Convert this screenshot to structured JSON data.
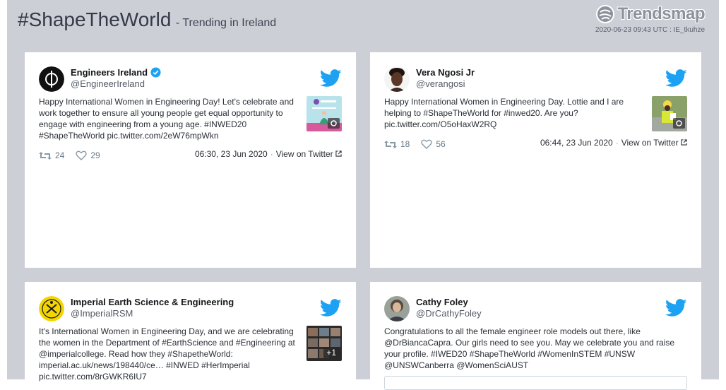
{
  "header": {
    "hashtag": "#ShapeTheWorld",
    "subtitle": "- Trending in Ireland",
    "brand": "Trendsmap",
    "stamp": "2020-06-23 09:43 UTC : IE_tkuhze"
  },
  "tweets": [
    {
      "name": "Engineers Ireland",
      "verified": true,
      "handle": "@EngineerIreland",
      "lines": [
        "Happy International Women in Engineering Day! Let's celebrate and",
        "work together to ensure all young people get equal opportunity to",
        "engage with engineering from a young age. #INWED20",
        "#ShapeTheWorld pic.twitter.com/2eW76mpWkn"
      ],
      "retweets": "24",
      "likes": "29",
      "time": "06:30, 23 Jun 2020",
      "view_label": "View on Twitter"
    },
    {
      "name": "Vera Ngosi Jr",
      "verified": false,
      "handle": "@verangosi",
      "lines": [
        "Happy International Women in Engineering Day. Lottie and I are",
        "helping to #ShapeTheWorld for #inwed20. Are you?",
        "pic.twitter.com/O5oHaxW2RQ"
      ],
      "retweets": "18",
      "likes": "56",
      "time": "06:44, 23 Jun 2020",
      "view_label": "View on Twitter"
    },
    {
      "name": "Imperial Earth Science & Engineering",
      "verified": false,
      "handle": "@ImperialRSM",
      "lines": [
        "It's International Women in Engineering Day, and we are celebrating",
        "the women in the Department of #EarthScience and #Engineering at",
        "@imperialcollege. Read how they #ShapetheWorld:",
        "imperial.ac.uk/news/198440/ce… #INWED #HerImperial",
        "pic.twitter.com/8rGWKR6IU7"
      ],
      "thumb_badge": "+1"
    },
    {
      "name": "Cathy Foley",
      "verified": false,
      "handle": "@DrCathyFoley",
      "lines": [
        "Congratulations to all the female engineer role models out there, like",
        "@DrBiancaCapra. Our girls need to see you. May we celebrate you and raise",
        "your profile. #IWED20 #ShapeTheWorld #WomenInSTEM #UNSW",
        "@UNSWCanberra @WomenSciAUST"
      ]
    }
  ],
  "colors": {
    "background": "#cdcfd7",
    "card": "#ffffff",
    "twitter_blue": "#1da1f2",
    "verified": "#1da1f2"
  },
  "icons": [
    "trendsmap-logo-icon",
    "twitter-bird-icon",
    "verified-badge-icon",
    "retweet-icon",
    "heart-icon",
    "external-link-icon",
    "camera-icon"
  ]
}
